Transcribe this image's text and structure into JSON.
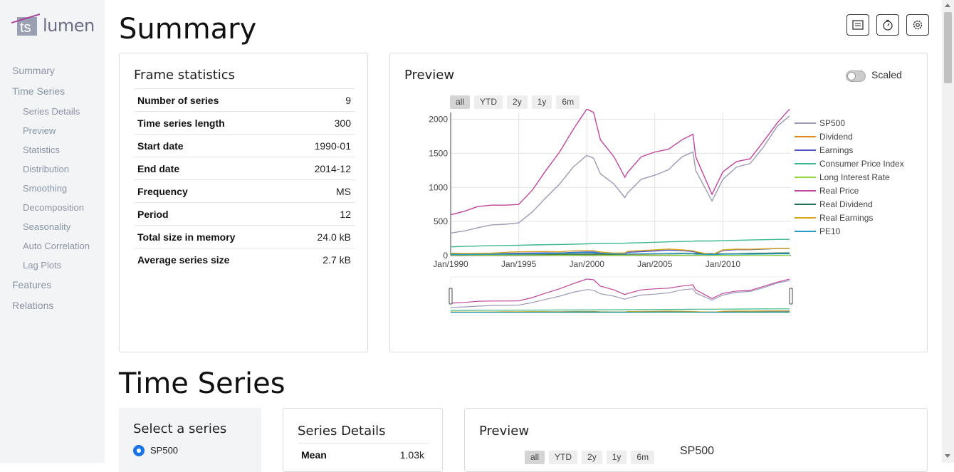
{
  "app": {
    "logo_ts": "ts",
    "logo_name": "lumen"
  },
  "sidebar": {
    "items": [
      {
        "label": "Summary",
        "level": 0
      },
      {
        "label": "Time Series",
        "level": 0
      },
      {
        "label": "Series Details",
        "level": 1
      },
      {
        "label": "Preview",
        "level": 1
      },
      {
        "label": "Statistics",
        "level": 1
      },
      {
        "label": "Distribution",
        "level": 1
      },
      {
        "label": "Smoothing",
        "level": 1
      },
      {
        "label": "Decomposition",
        "level": 1
      },
      {
        "label": "Seasonality",
        "level": 1
      },
      {
        "label": "Auto Correlation",
        "level": 1
      },
      {
        "label": "Lag Plots",
        "level": 1
      },
      {
        "label": "Features",
        "level": 0
      },
      {
        "label": "Relations",
        "level": 0
      }
    ]
  },
  "header": {
    "title": "Summary",
    "buttons": [
      "notes-icon",
      "timer-icon",
      "gear-icon"
    ]
  },
  "frame_stats": {
    "title": "Frame statistics",
    "rows": [
      {
        "key": "Number of series",
        "value": "9"
      },
      {
        "key": "Time series length",
        "value": "300"
      },
      {
        "key": "Start date",
        "value": "1990-01"
      },
      {
        "key": "End date",
        "value": "2014-12"
      },
      {
        "key": "Frequency",
        "value": "MS"
      },
      {
        "key": "Period",
        "value": "12"
      },
      {
        "key": "Total size in memory",
        "value": "24.0 kB"
      },
      {
        "key": "Average series size",
        "value": "2.7 kB"
      }
    ]
  },
  "preview": {
    "title": "Preview",
    "scaled_label": "Scaled",
    "range_buttons": [
      "all",
      "YTD",
      "2y",
      "1y",
      "6m"
    ],
    "active_range": "all"
  },
  "chart_data": {
    "type": "line",
    "x_tick_labels": [
      "Jan/1990",
      "Jan/1995",
      "Jan/2000",
      "Jan/2005",
      "Jan/2010"
    ],
    "y_tick_labels": [
      "0",
      "500",
      "1000",
      "1500",
      "2000"
    ],
    "ylim": [
      0,
      2100
    ],
    "xlim": [
      1990.0,
      2015.0
    ],
    "x": [
      1990,
      1991,
      1992,
      1993,
      1994,
      1995,
      1996,
      1997,
      1998,
      1999,
      2000,
      2000.5,
      2001,
      2002,
      2002.8,
      2003,
      2004,
      2005,
      2006,
      2007,
      2007.8,
      2008,
      2009.2,
      2010,
      2011,
      2012,
      2013,
      2014,
      2014.9
    ],
    "series": [
      {
        "name": "SP500",
        "color": "#9b9bb8",
        "values": [
          330,
          360,
          410,
          450,
          460,
          480,
          640,
          850,
          1050,
          1300,
          1470,
          1430,
          1200,
          1050,
          850,
          920,
          1120,
          1180,
          1260,
          1450,
          1520,
          1250,
          800,
          1120,
          1300,
          1350,
          1600,
          1900,
          2050
        ]
      },
      {
        "name": "Dividend",
        "color": "#e08a1e",
        "values": [
          12,
          13,
          13,
          14,
          14,
          14,
          15,
          15,
          16,
          16,
          16,
          16,
          16,
          16,
          16,
          17,
          19,
          22,
          25,
          28,
          28,
          28,
          24,
          23,
          26,
          31,
          34,
          38,
          40
        ]
      },
      {
        "name": "Earnings",
        "color": "#4b4fc4",
        "values": [
          20,
          17,
          19,
          22,
          30,
          35,
          38,
          40,
          37,
          48,
          52,
          52,
          38,
          28,
          30,
          48,
          58,
          68,
          80,
          72,
          60,
          50,
          10,
          75,
          87,
          87,
          95,
          103,
          103
        ]
      },
      {
        "name": "Consumer Price Index",
        "color": "#3cb88a",
        "values": [
          128,
          135,
          140,
          145,
          148,
          152,
          157,
          160,
          163,
          166,
          172,
          174,
          177,
          180,
          182,
          184,
          189,
          195,
          202,
          207,
          210,
          215,
          214,
          218,
          224,
          229,
          233,
          237,
          238
        ]
      },
      {
        "name": "Long Interest Rate",
        "color": "#8fd43a",
        "values": [
          8,
          8,
          7,
          6,
          7,
          7,
          6,
          6,
          5,
          5,
          6,
          6,
          5,
          5,
          4,
          4,
          4,
          4,
          5,
          5,
          4,
          4,
          3,
          3,
          3,
          2,
          2,
          3,
          2
        ]
      },
      {
        "name": "Real Price",
        "color": "#c2449e",
        "values": [
          600,
          650,
          720,
          740,
          740,
          750,
          960,
          1250,
          1520,
          1850,
          2150,
          2100,
          1700,
          1450,
          1150,
          1220,
          1450,
          1520,
          1560,
          1700,
          1780,
          1450,
          900,
          1230,
          1380,
          1420,
          1680,
          1950,
          2150
        ]
      },
      {
        "name": "Real Dividend",
        "color": "#1f6e55",
        "values": [
          22,
          23,
          22,
          22,
          22,
          22,
          22,
          22,
          22,
          22,
          22,
          22,
          22,
          21,
          21,
          22,
          24,
          27,
          30,
          33,
          32,
          31,
          27,
          25,
          27,
          32,
          34,
          38,
          40
        ]
      },
      {
        "name": "Real Earnings",
        "color": "#d9a520",
        "values": [
          36,
          30,
          33,
          36,
          48,
          55,
          58,
          60,
          55,
          70,
          72,
          72,
          52,
          38,
          40,
          62,
          74,
          84,
          96,
          84,
          70,
          58,
          12,
          84,
          95,
          93,
          99,
          106,
          105
        ]
      },
      {
        "name": "PE10",
        "color": "#2b9ac8",
        "values": [
          17,
          17,
          19,
          20,
          21,
          20,
          24,
          28,
          33,
          40,
          43,
          40,
          33,
          27,
          22,
          23,
          26,
          26,
          26,
          27,
          26,
          22,
          15,
          20,
          22,
          21,
          23,
          25,
          26
        ]
      }
    ]
  },
  "time_series": {
    "title": "Time Series",
    "select_title": "Select a series",
    "selected_series": "SP500",
    "details_title": "Series Details",
    "details_rows": [
      {
        "key": "Mean",
        "value": "1.03k"
      }
    ],
    "preview_title": "Preview",
    "preview_chart_title": "SP500",
    "range_buttons": [
      "all",
      "YTD",
      "2y",
      "1y",
      "6m"
    ]
  }
}
